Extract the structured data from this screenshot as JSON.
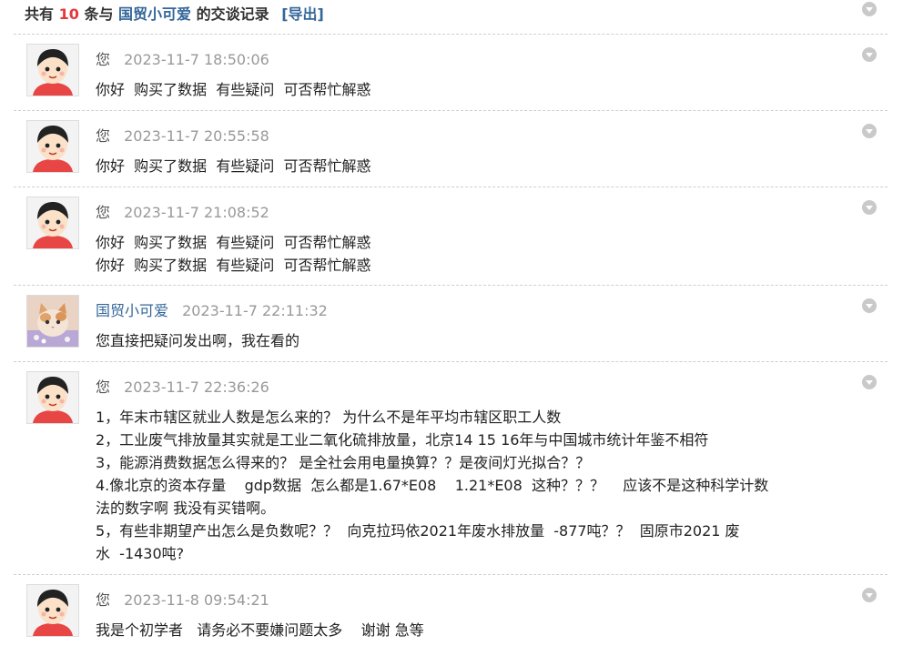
{
  "header": {
    "prefix": "共有",
    "count": "10",
    "middle": "条与",
    "partner": "国贸小可爱",
    "suffix": "的交谈记录",
    "export_label": "[导出]"
  },
  "messages": [
    {
      "sender": "您",
      "time": "2023-11-7 18:50:06",
      "lines": [
        "你好  购买了数据  有些疑问  可否帮忙解惑"
      ]
    },
    {
      "sender": "您",
      "time": "2023-11-7 20:55:58",
      "lines": [
        "你好  购买了数据  有些疑问  可否帮忙解惑"
      ]
    },
    {
      "sender": "您",
      "time": "2023-11-7 21:08:52",
      "lines": [
        "你好  购买了数据  有些疑问  可否帮忙解惑",
        "你好  购买了数据  有些疑问  可否帮忙解惑"
      ]
    },
    {
      "sender": "国贸小可爱",
      "time": "2023-11-7 22:11:32",
      "lines": [
        "您直接把疑问发出啊，我在看的"
      ]
    },
    {
      "sender": "您",
      "time": "2023-11-7 22:36:26",
      "lines": [
        "1，年末市辖区就业人数是怎么来的？ 为什么不是年平均市辖区职工人数",
        "2，工业废气排放量其实就是工业二氧化硫排放量，北京14 15 16年与中国城市统计年鉴不相符",
        "3，能源消费数据怎么得来的？ 是全社会用电量换算？？是夜间灯光拟合？？",
        "4.像北京的资本存量    gdp数据  怎么都是1.67*E08    1.21*E08  这种？？？    应该不是这种科学计数",
        "法的数字啊 我没有买错啊。",
        "5，有些非期望产出怎么是负数呢？？  向克拉玛依2021年废水排放量  -877吨？？  固原市2021 废",
        "水  -1430吨?"
      ]
    },
    {
      "sender": "您",
      "time": "2023-11-8 09:54:21",
      "lines": [
        "我是个初学者   请务必不要嫌问题太多    谢谢 急等"
      ]
    }
  ]
}
